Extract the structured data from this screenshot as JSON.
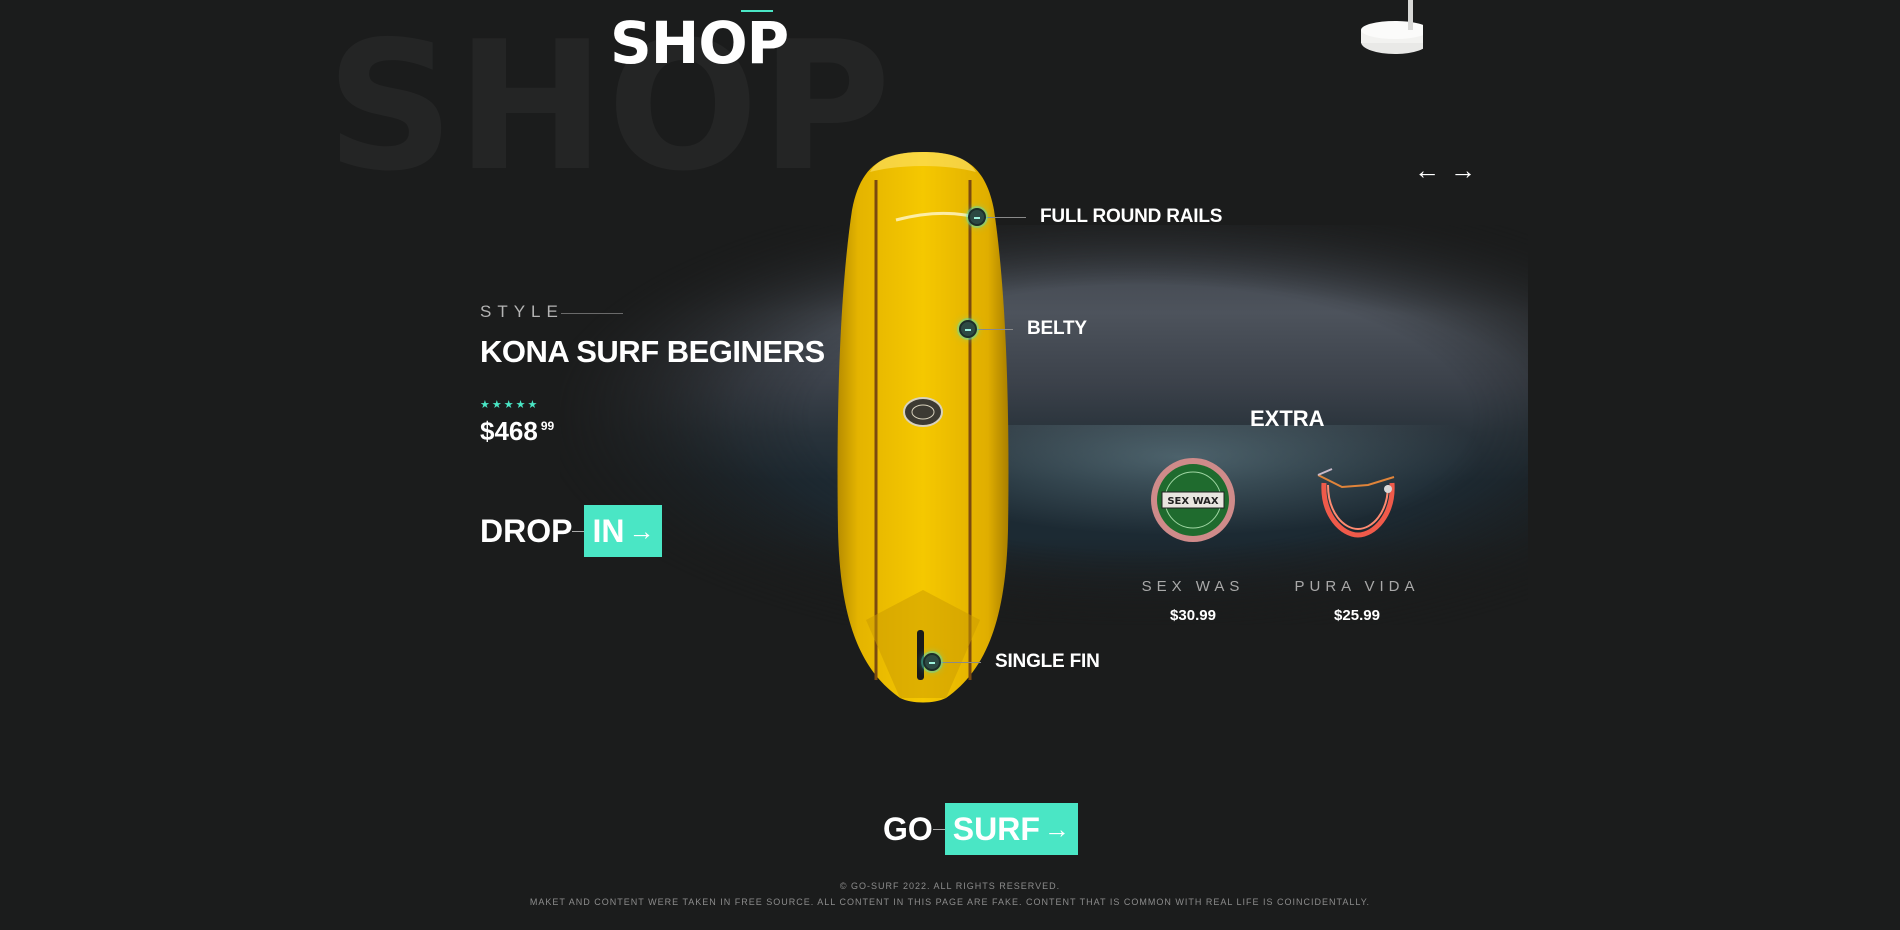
{
  "header": {
    "title": "SHOP",
    "ghost_title": "SHOP"
  },
  "product": {
    "style_label": "STYLE",
    "name": "KONA SURF BEGINERS",
    "rating_stars": "★★★★★",
    "rating": 5,
    "price_main": "$468",
    "price_cents": "99",
    "cta_word": "DROP",
    "cta_box": "IN"
  },
  "callouts": {
    "rails": "FULL ROUND RAILS",
    "belty": "BELTY",
    "fin": "SINGLE FIN"
  },
  "extras": {
    "title": "EXTRA",
    "items": [
      {
        "name": "SEX WAS",
        "price": "$30.99",
        "thumb_text": "SEX WAX"
      },
      {
        "name": "PURA VIDA",
        "price": "$25.99"
      }
    ]
  },
  "go_cta": {
    "word": "GO",
    "box": "SURF"
  },
  "nav": {
    "prev_icon": "arrow-left-icon",
    "next_icon": "arrow-right-icon"
  },
  "footer": {
    "line1": "© GO-SURF 2022. ALL RIGHTS RESERVED.",
    "line2": "MAKET AND CONTENT WERE TAKEN IN FREE SOURCE. ALL CONTENT IN THIS PAGE ARE FAKE. CONTENT THAT IS COMMON WITH REAL LIFE IS COINCIDENTALLY."
  },
  "colors": {
    "background": "#1b1c1c",
    "accent": "#4ae6c5",
    "board": "#f0c200"
  }
}
